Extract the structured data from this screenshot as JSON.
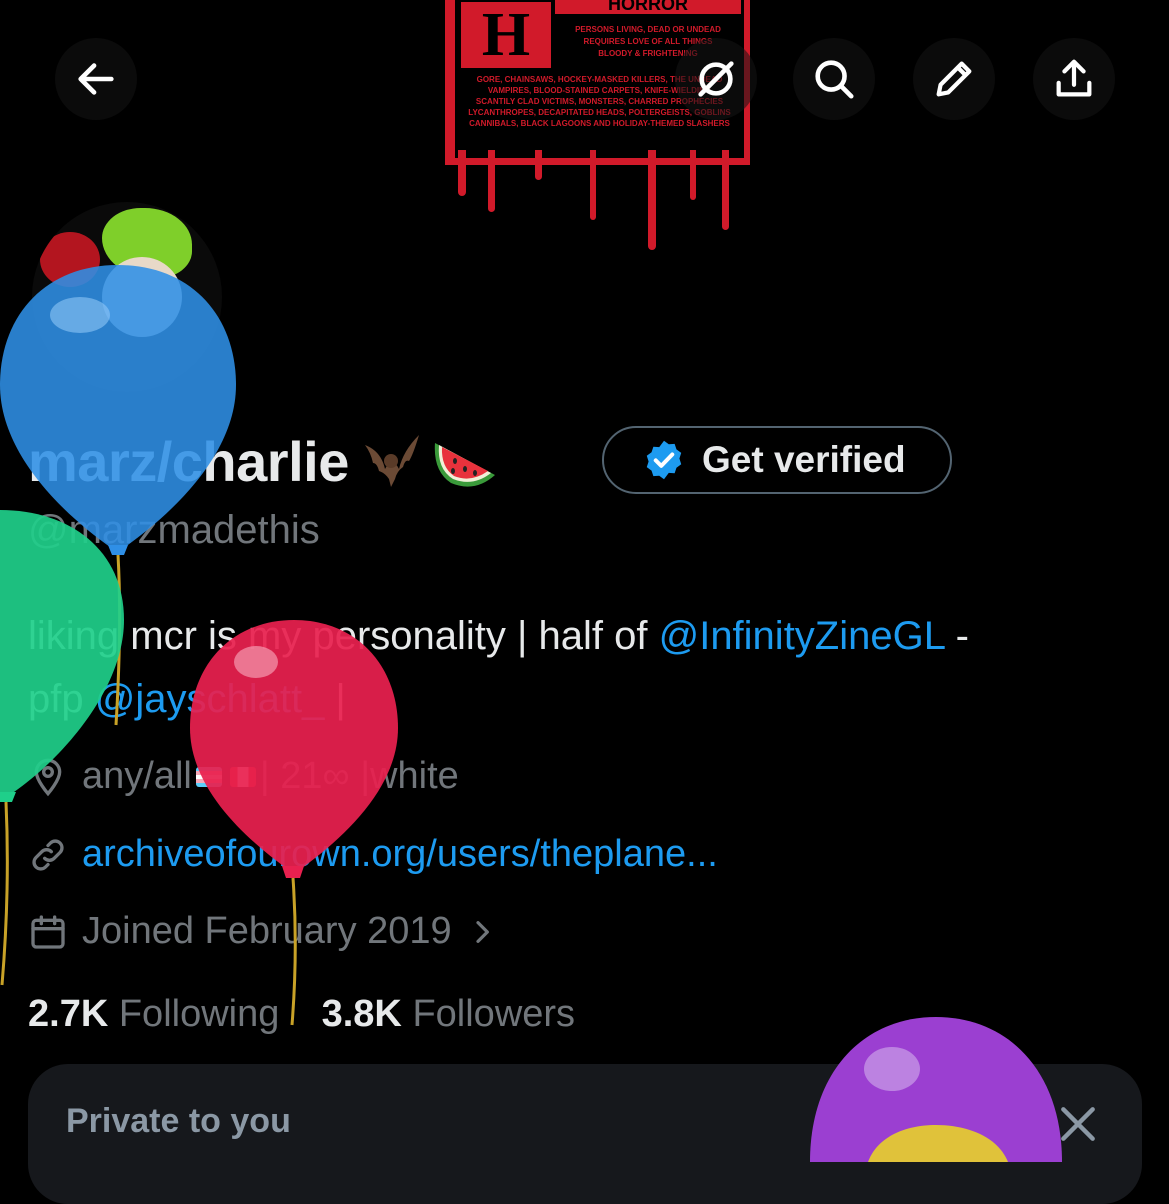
{
  "header": {
    "back_icon": "arrow-left-icon",
    "grok_icon": "grok-icon",
    "search_icon": "search-icon",
    "edit_icon": "pencil-icon",
    "share_icon": "share-icon"
  },
  "banner": {
    "poster_letter": "H",
    "poster_word": "HORROR",
    "line1": "Persons living, dead or undead",
    "line2": "requires love of all things",
    "line3": "bloody & frightening",
    "line4": "Gore, chainsaws, hockey-masked killers, the undead",
    "line5": "vampires, blood-stained carpets, knife-wielding",
    "line6": "scantily clad victims, monsters, charred prophecies",
    "line7": "lycanthropes, decapitated heads, poltergeists, goblins",
    "line8": "cannibals, black lagoons and holiday-themed slashers"
  },
  "profile": {
    "display_name": "marz/charlie",
    "get_verified_label": "Get verified",
    "handle": "@marzmadethis",
    "bio_part1": "liking mcr is my personality | half of ",
    "bio_mention1": "@InfinityZineGL",
    "bio_part2": " -",
    "bio_part3": "pfp ",
    "bio_mention2": "@jayschlatt_",
    "bio_part4": " |",
    "location_text1": "any/all",
    "location_text2": "| 21∞ |white",
    "website": "archiveofourown.org/users/theplane...",
    "joined": "Joined February 2019",
    "following_count": "2.7K",
    "following_label": "Following",
    "followers_count": "3.8K",
    "followers_label": "Followers"
  },
  "private_card": {
    "label": "Private to you"
  },
  "colors": {
    "accent": "#1d9bf0",
    "muted": "#71767b",
    "poster_red": "#d11a2a"
  }
}
